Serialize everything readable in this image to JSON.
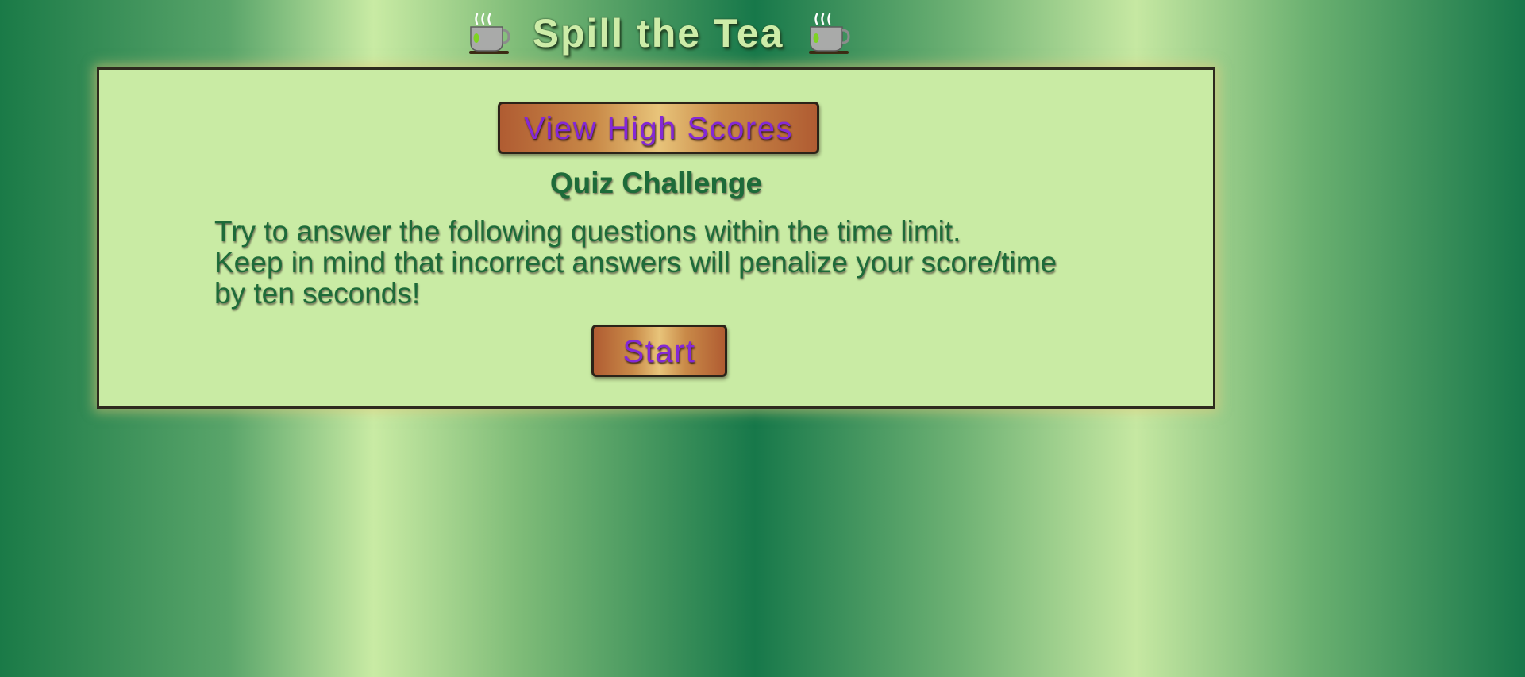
{
  "header": {
    "title": "Spill the Tea",
    "left_icon": "teacup-icon",
    "right_icon": "teacup-icon"
  },
  "panel": {
    "high_scores_button": "View High Scores",
    "quiz_title": "Quiz Challenge",
    "intro_lines": [
      "Try to answer the following questions within the time limit.",
      "Keep in mind that incorrect answers will penalize your score/time",
      "by ten seconds!"
    ],
    "start_button": "Start"
  },
  "colors": {
    "background_dark": "#17784a",
    "background_light": "#c9eba4",
    "panel_bg": "#c9eba4",
    "text_green": "#1d6b39",
    "button_text": "#8428d6",
    "button_bronze": "#b05c32",
    "button_gold": "#e8c47a"
  }
}
